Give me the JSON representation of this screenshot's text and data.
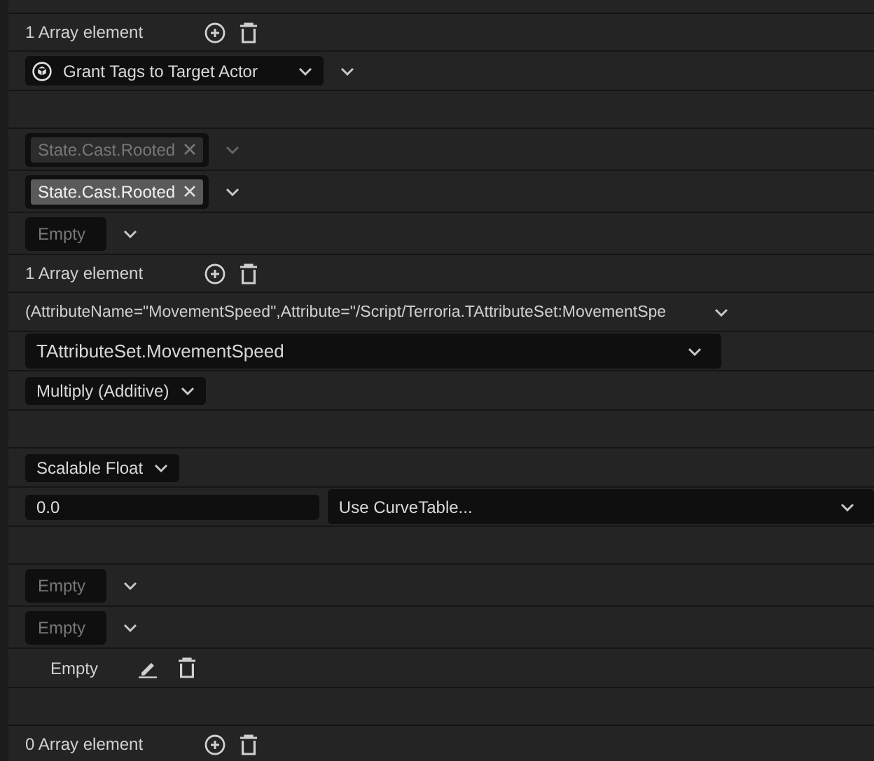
{
  "rows": [
    {
      "kind": "array",
      "label": "1 Array element"
    },
    {
      "kind": "class_select",
      "value": "Grant Tags to Target Actor"
    },
    {
      "kind": "blank"
    },
    {
      "kind": "tag",
      "tag": "State.Cast.Rooted",
      "disabled": true
    },
    {
      "kind": "tag",
      "tag": "State.Cast.Rooted",
      "disabled": false
    },
    {
      "kind": "combo",
      "value": "Empty"
    },
    {
      "kind": "array",
      "label": "1 Array element"
    },
    {
      "kind": "text",
      "value": "(AttributeName=\"MovementSpeed\",Attribute=\"/Script/Terroria.TAttributeSet:MovementSpe"
    },
    {
      "kind": "wide_select",
      "value": "TAttributeSet.MovementSpeed"
    },
    {
      "kind": "select",
      "value": "Multiply (Additive)"
    },
    {
      "kind": "blank"
    },
    {
      "kind": "select",
      "value": "Scalable Float"
    },
    {
      "kind": "float",
      "value": "0.0",
      "table": "Use CurveTable..."
    },
    {
      "kind": "blank"
    },
    {
      "kind": "combo",
      "value": "Empty"
    },
    {
      "kind": "combo",
      "value": "Empty"
    },
    {
      "kind": "asset",
      "value": "Empty"
    },
    {
      "kind": "blank"
    },
    {
      "kind": "array",
      "label": "0 Array element"
    }
  ]
}
